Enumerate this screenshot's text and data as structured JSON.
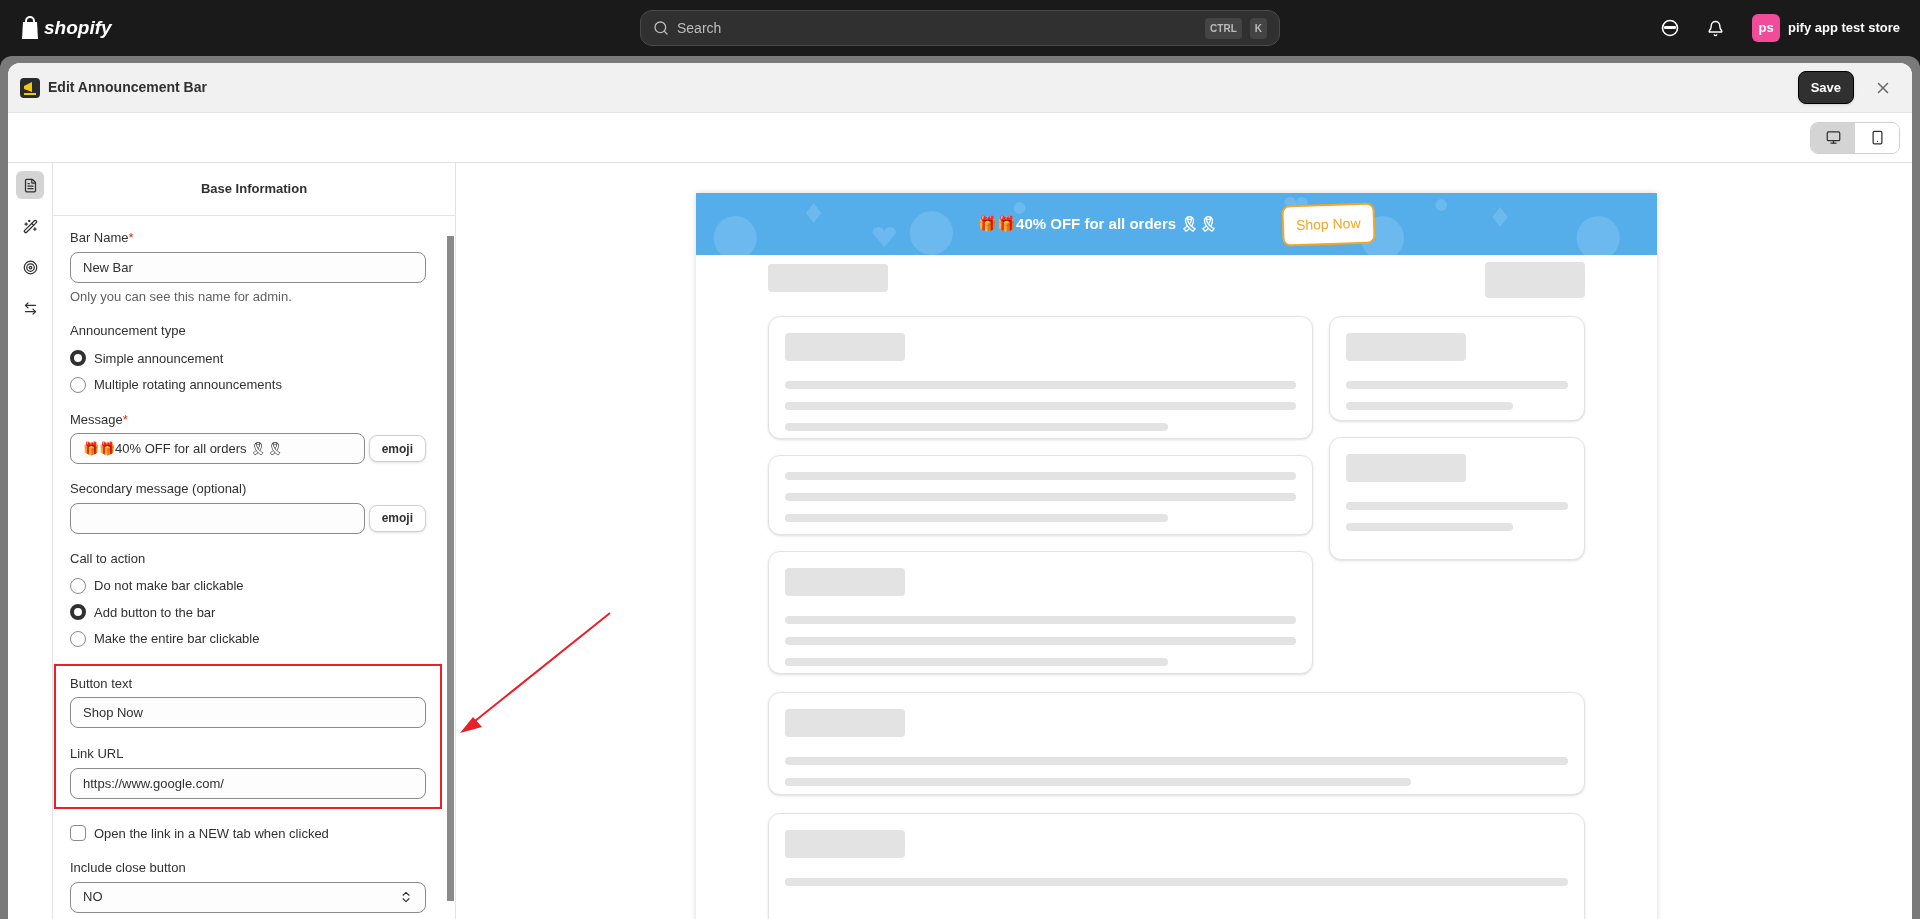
{
  "topbar": {
    "brand": "shopify",
    "search": {
      "placeholder": "Search",
      "keys": [
        "CTRL",
        "K"
      ]
    },
    "store": {
      "initials": "ps",
      "name": "pify app test store"
    }
  },
  "modal": {
    "title": "Edit Announcement Bar",
    "save": "Save",
    "view_modes": [
      {
        "kind": "desktop",
        "selected": true
      },
      {
        "kind": "mobile",
        "selected": false
      }
    ]
  },
  "rail": [
    {
      "kind": "content",
      "selected": true
    },
    {
      "kind": "design",
      "selected": false
    },
    {
      "kind": "target",
      "selected": false
    },
    {
      "kind": "settings",
      "selected": false
    }
  ],
  "form": {
    "title": "Base Information",
    "fields": [
      {
        "kind": "text",
        "label": "Bar Name",
        "required_mark": "*",
        "value": "New Bar",
        "help": "Only you can see this name for admin."
      },
      {
        "kind": "radio",
        "label": "Announcement type",
        "options": [
          {
            "label": "Simple announcement",
            "selected": true
          },
          {
            "label": "Multiple rotating announcements",
            "selected": false
          }
        ]
      },
      {
        "kind": "emoji",
        "label": "Message",
        "required_mark": "*",
        "value": "🎁🎁40% OFF for all orders 🎗🎗",
        "button": "emoji"
      },
      {
        "kind": "emoji",
        "label": "Secondary message (optional)",
        "button": "emoji"
      },
      {
        "kind": "radio",
        "label": "Call to action",
        "options": [
          {
            "label": "Do not make bar clickable",
            "selected": false
          },
          {
            "label": "Add button to the bar",
            "selected": true
          },
          {
            "label": "Make the entire bar clickable",
            "selected": false
          }
        ]
      },
      {
        "kind": "group",
        "highlighted": true,
        "children": [
          {
            "kind": "text",
            "label": "Button text",
            "value": "Shop Now"
          },
          {
            "kind": "text",
            "label": "Link URL",
            "value": "https://www.google.com/"
          }
        ]
      },
      {
        "kind": "checkbox",
        "label": "Open the link in a NEW tab when clicked",
        "checked": false
      },
      {
        "kind": "select",
        "label": "Include close button",
        "value": "NO"
      }
    ]
  },
  "preview": {
    "bar": {
      "message": "🎁🎁40% OFF for all orders 🎗🎗",
      "button": "Shop Now"
    }
  }
}
